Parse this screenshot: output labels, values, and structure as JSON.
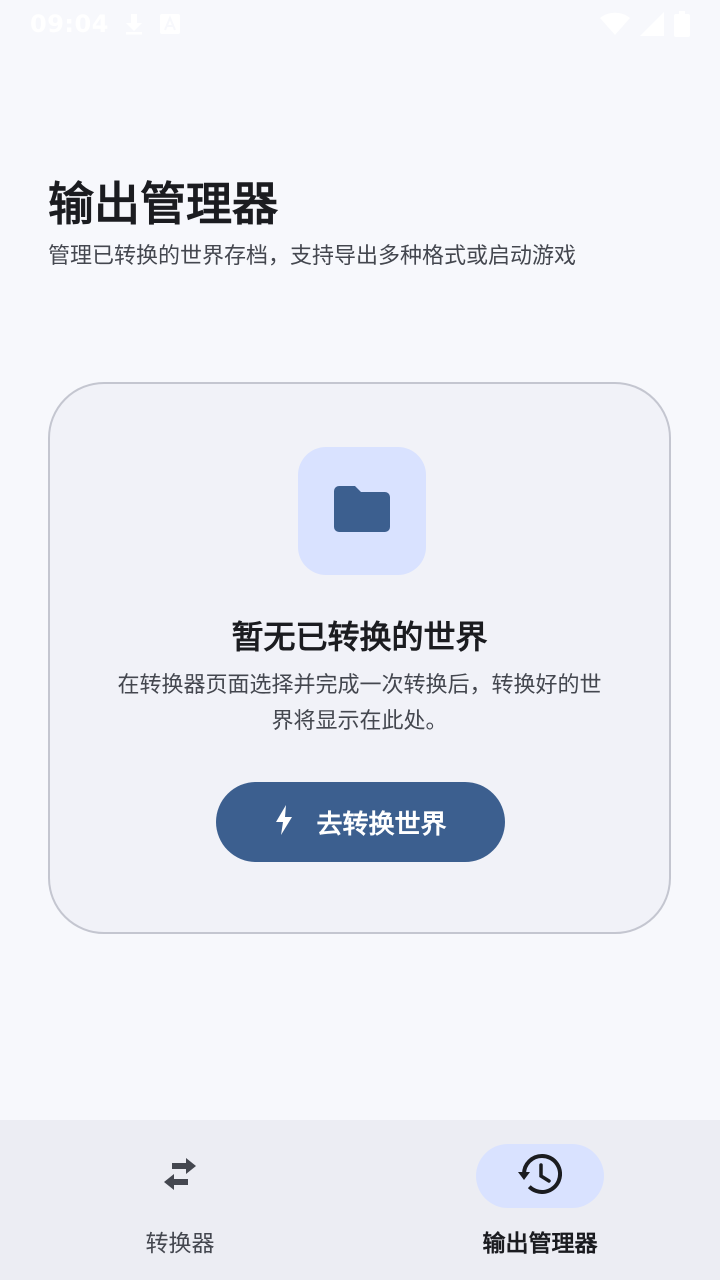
{
  "status_bar": {
    "time": "09:04",
    "icons": [
      "download-icon",
      "notification-a-icon",
      "wifi-icon",
      "cellular-icon",
      "battery-icon"
    ]
  },
  "header": {
    "title": "输出管理器",
    "subtitle": "管理已转换的世界存档，支持导出多种格式或启动游戏"
  },
  "empty_state": {
    "icon": "folder-icon",
    "title": "暂无已转换的世界",
    "description": "在转换器页面选择并完成一次转换后，转换好的世界将显示在此处。",
    "button": {
      "icon": "bolt-icon",
      "label": "去转换世界"
    }
  },
  "bottom_nav": {
    "items": [
      {
        "icon": "swap-arrows-icon",
        "label": "转换器",
        "active": false
      },
      {
        "icon": "history-icon",
        "label": "输出管理器",
        "active": true
      }
    ]
  },
  "colors": {
    "background": "#f7f8fc",
    "card_background": "#f1f2f8",
    "card_border": "#c4c6d0",
    "accent": "#3c5f8f",
    "accent_container": "#d9e2ff",
    "nav_background": "#ecedf3"
  }
}
